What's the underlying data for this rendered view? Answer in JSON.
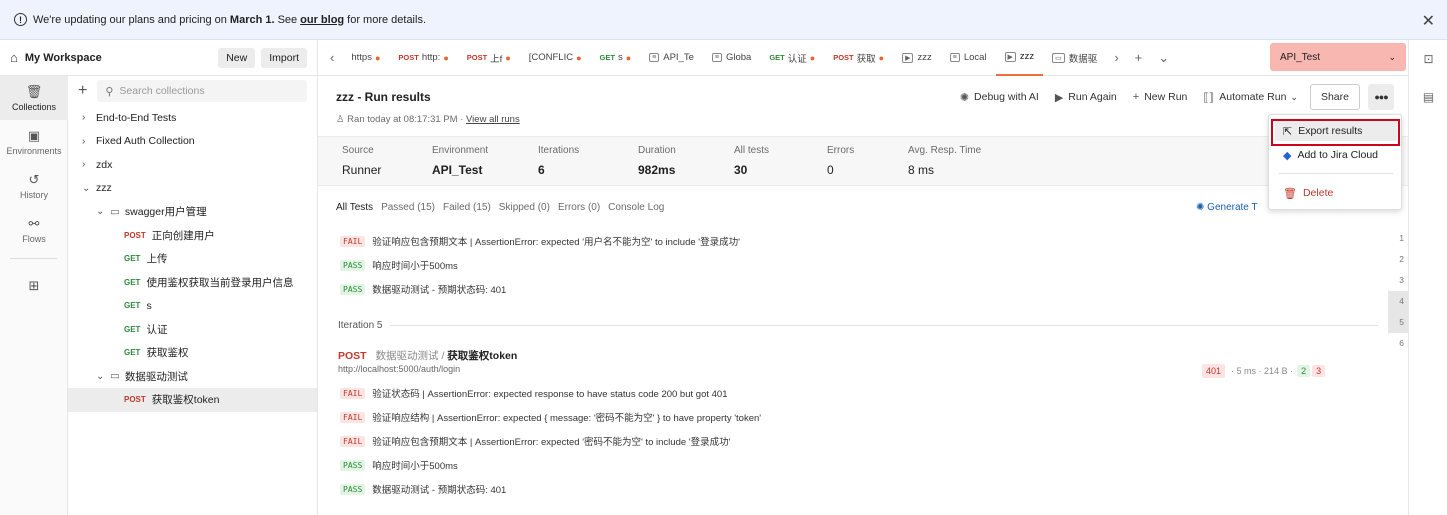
{
  "banner": {
    "text_before": "We're updating our plans and pricing on",
    "date": "March 1.",
    "text_mid": "See",
    "link": "our blog",
    "text_after": "for more details."
  },
  "workspace": {
    "name": "My Workspace",
    "new_label": "New",
    "import_label": "Import"
  },
  "sidebar": {
    "items": [
      {
        "label": "Collections",
        "icon": "collections-icon"
      },
      {
        "label": "Environments",
        "icon": "environments-icon"
      },
      {
        "label": "History",
        "icon": "history-icon"
      },
      {
        "label": "Flows",
        "icon": "flows-icon"
      }
    ]
  },
  "collections": {
    "search_placeholder": "Search collections",
    "rows": [
      {
        "label": "End-to-End Tests"
      },
      {
        "label": "Fixed Auth Collection"
      },
      {
        "label": "zdx"
      },
      {
        "label": "zzz"
      },
      {
        "label": "swagger用户管理"
      },
      {
        "method": "POST",
        "label": "正向创建用户"
      },
      {
        "method": "GET",
        "label": "上传"
      },
      {
        "method": "GET",
        "label": "使用鉴权获取当前登录用户信息"
      },
      {
        "method": "GET",
        "label": "s"
      },
      {
        "method": "GET",
        "label": "认证"
      },
      {
        "method": "GET",
        "label": "获取鉴权"
      },
      {
        "label": "数据驱动测试"
      },
      {
        "method": "POST",
        "label": "获取鉴权token"
      }
    ]
  },
  "tabs": [
    {
      "method": "",
      "label": "https",
      "dot": true
    },
    {
      "method": "POST",
      "label": "http:",
      "dot": true
    },
    {
      "method": "POST",
      "label": "上f",
      "dot": true
    },
    {
      "method": "",
      "label": "[CONFLIC",
      "dot": true
    },
    {
      "method": "GET",
      "label": "s",
      "dot": true
    },
    {
      "box": "≡",
      "label": "API_Te"
    },
    {
      "box": "≡",
      "label": "Globa"
    },
    {
      "method": "GET",
      "label": "认证",
      "dot": true
    },
    {
      "method": "POST",
      "label": "获取",
      "dot": true
    },
    {
      "box": "▶",
      "label": "zzz"
    },
    {
      "box": "≡",
      "label": "Local"
    },
    {
      "box": "▶",
      "label": "zzz"
    },
    {
      "box": "▭",
      "label": "数据驱"
    }
  ],
  "environment": {
    "selected": "API_Test"
  },
  "run": {
    "title": "zzz - Run results",
    "subtitle": "Ran today at 08:17:31 PM",
    "view_all": "View all runs",
    "actions": {
      "debug": "Debug with AI",
      "run_again": "Run Again",
      "new_run": "New Run",
      "automate": "Automate Run",
      "share": "Share"
    }
  },
  "stats": [
    {
      "label": "Source",
      "value": "Runner"
    },
    {
      "label": "Environment",
      "value": "API_Test"
    },
    {
      "label": "Iterations",
      "value": "6"
    },
    {
      "label": "Duration",
      "value": "982ms"
    },
    {
      "label": "All tests",
      "value": "30"
    },
    {
      "label": "Errors",
      "value": "0"
    },
    {
      "label": "Avg. Resp. Time",
      "value": "8 ms"
    }
  ],
  "subtabs": [
    "All Tests",
    "Passed (15)",
    "Failed (15)",
    "Skipped (0)",
    "Errors (0)",
    "Console Log"
  ],
  "generate_label": "Generate T",
  "results_top": [
    {
      "status": "FAIL",
      "text": "验证响应包含预期文本 | AssertionError: expected '用户名不能为空' to include '登录成功'"
    },
    {
      "status": "PASS",
      "text": "响应时间小于500ms"
    },
    {
      "status": "PASS",
      "text": "数据驱动测试 - 预期状态码: 401"
    }
  ],
  "iteration_label": "Iteration 5",
  "request": {
    "method": "POST",
    "crumb": "数据驱动测试",
    "sep": "/",
    "name": "获取鉴权token",
    "url": "http://localhost:5000/auth/login",
    "code": "401",
    "time": "5 ms",
    "size": "214 B",
    "passed": "2",
    "failed": "3"
  },
  "results_bottom": [
    {
      "status": "FAIL",
      "text": "验证状态码 | AssertionError: expected response to have status code 200 but got 401"
    },
    {
      "status": "FAIL",
      "text": "验证响应结构 | AssertionError: expected { message: '密码不能为空' } to have property 'token'"
    },
    {
      "status": "FAIL",
      "text": "验证响应包含预期文本 | AssertionError: expected '密码不能为空' to include '登录成功'"
    },
    {
      "status": "PASS",
      "text": "响应时间小于500ms"
    },
    {
      "status": "PASS",
      "text": "数据驱动测试 - 预期状态码: 401"
    }
  ],
  "line_numbers": [
    "1",
    "2",
    "3",
    "4",
    "5",
    "6"
  ],
  "menu": {
    "export": "Export results",
    "jira": "Add to Jira Cloud",
    "delete": "Delete"
  }
}
